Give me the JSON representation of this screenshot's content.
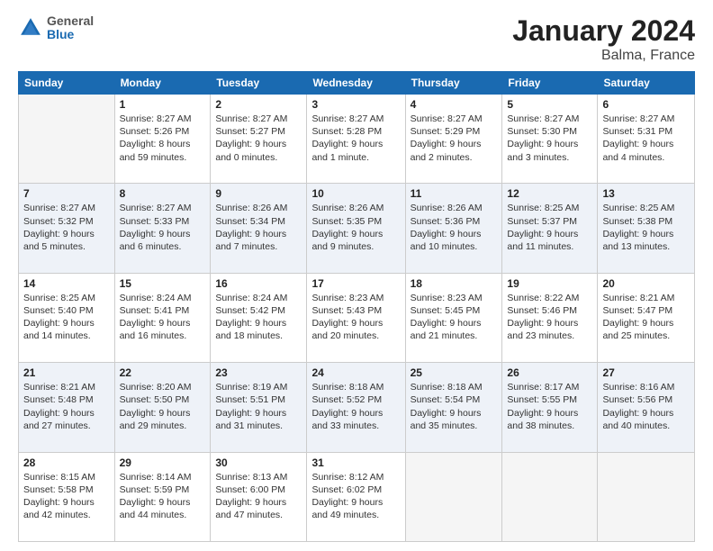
{
  "header": {
    "logo": {
      "line1": "General",
      "line2": "Blue"
    },
    "title": "January 2024",
    "subtitle": "Balma, France"
  },
  "calendar": {
    "days_of_week": [
      "Sunday",
      "Monday",
      "Tuesday",
      "Wednesday",
      "Thursday",
      "Friday",
      "Saturday"
    ],
    "weeks": [
      [
        {
          "day": null
        },
        {
          "day": 1,
          "sunrise": "8:27 AM",
          "sunset": "5:26 PM",
          "daylight": "8 hours and 59 minutes."
        },
        {
          "day": 2,
          "sunrise": "8:27 AM",
          "sunset": "5:27 PM",
          "daylight": "9 hours and 0 minutes."
        },
        {
          "day": 3,
          "sunrise": "8:27 AM",
          "sunset": "5:28 PM",
          "daylight": "9 hours and 1 minute."
        },
        {
          "day": 4,
          "sunrise": "8:27 AM",
          "sunset": "5:29 PM",
          "daylight": "9 hours and 2 minutes."
        },
        {
          "day": 5,
          "sunrise": "8:27 AM",
          "sunset": "5:30 PM",
          "daylight": "9 hours and 3 minutes."
        },
        {
          "day": 6,
          "sunrise": "8:27 AM",
          "sunset": "5:31 PM",
          "daylight": "9 hours and 4 minutes."
        }
      ],
      [
        {
          "day": 7,
          "sunrise": "8:27 AM",
          "sunset": "5:32 PM",
          "daylight": "9 hours and 5 minutes."
        },
        {
          "day": 8,
          "sunrise": "8:27 AM",
          "sunset": "5:33 PM",
          "daylight": "9 hours and 6 minutes."
        },
        {
          "day": 9,
          "sunrise": "8:26 AM",
          "sunset": "5:34 PM",
          "daylight": "9 hours and 7 minutes."
        },
        {
          "day": 10,
          "sunrise": "8:26 AM",
          "sunset": "5:35 PM",
          "daylight": "9 hours and 9 minutes."
        },
        {
          "day": 11,
          "sunrise": "8:26 AM",
          "sunset": "5:36 PM",
          "daylight": "9 hours and 10 minutes."
        },
        {
          "day": 12,
          "sunrise": "8:25 AM",
          "sunset": "5:37 PM",
          "daylight": "9 hours and 11 minutes."
        },
        {
          "day": 13,
          "sunrise": "8:25 AM",
          "sunset": "5:38 PM",
          "daylight": "9 hours and 13 minutes."
        }
      ],
      [
        {
          "day": 14,
          "sunrise": "8:25 AM",
          "sunset": "5:40 PM",
          "daylight": "9 hours and 14 minutes."
        },
        {
          "day": 15,
          "sunrise": "8:24 AM",
          "sunset": "5:41 PM",
          "daylight": "9 hours and 16 minutes."
        },
        {
          "day": 16,
          "sunrise": "8:24 AM",
          "sunset": "5:42 PM",
          "daylight": "9 hours and 18 minutes."
        },
        {
          "day": 17,
          "sunrise": "8:23 AM",
          "sunset": "5:43 PM",
          "daylight": "9 hours and 20 minutes."
        },
        {
          "day": 18,
          "sunrise": "8:23 AM",
          "sunset": "5:45 PM",
          "daylight": "9 hours and 21 minutes."
        },
        {
          "day": 19,
          "sunrise": "8:22 AM",
          "sunset": "5:46 PM",
          "daylight": "9 hours and 23 minutes."
        },
        {
          "day": 20,
          "sunrise": "8:21 AM",
          "sunset": "5:47 PM",
          "daylight": "9 hours and 25 minutes."
        }
      ],
      [
        {
          "day": 21,
          "sunrise": "8:21 AM",
          "sunset": "5:48 PM",
          "daylight": "9 hours and 27 minutes."
        },
        {
          "day": 22,
          "sunrise": "8:20 AM",
          "sunset": "5:50 PM",
          "daylight": "9 hours and 29 minutes."
        },
        {
          "day": 23,
          "sunrise": "8:19 AM",
          "sunset": "5:51 PM",
          "daylight": "9 hours and 31 minutes."
        },
        {
          "day": 24,
          "sunrise": "8:18 AM",
          "sunset": "5:52 PM",
          "daylight": "9 hours and 33 minutes."
        },
        {
          "day": 25,
          "sunrise": "8:18 AM",
          "sunset": "5:54 PM",
          "daylight": "9 hours and 35 minutes."
        },
        {
          "day": 26,
          "sunrise": "8:17 AM",
          "sunset": "5:55 PM",
          "daylight": "9 hours and 38 minutes."
        },
        {
          "day": 27,
          "sunrise": "8:16 AM",
          "sunset": "5:56 PM",
          "daylight": "9 hours and 40 minutes."
        }
      ],
      [
        {
          "day": 28,
          "sunrise": "8:15 AM",
          "sunset": "5:58 PM",
          "daylight": "9 hours and 42 minutes."
        },
        {
          "day": 29,
          "sunrise": "8:14 AM",
          "sunset": "5:59 PM",
          "daylight": "9 hours and 44 minutes."
        },
        {
          "day": 30,
          "sunrise": "8:13 AM",
          "sunset": "6:00 PM",
          "daylight": "9 hours and 47 minutes."
        },
        {
          "day": 31,
          "sunrise": "8:12 AM",
          "sunset": "6:02 PM",
          "daylight": "9 hours and 49 minutes."
        },
        {
          "day": null
        },
        {
          "day": null
        },
        {
          "day": null
        }
      ]
    ]
  }
}
